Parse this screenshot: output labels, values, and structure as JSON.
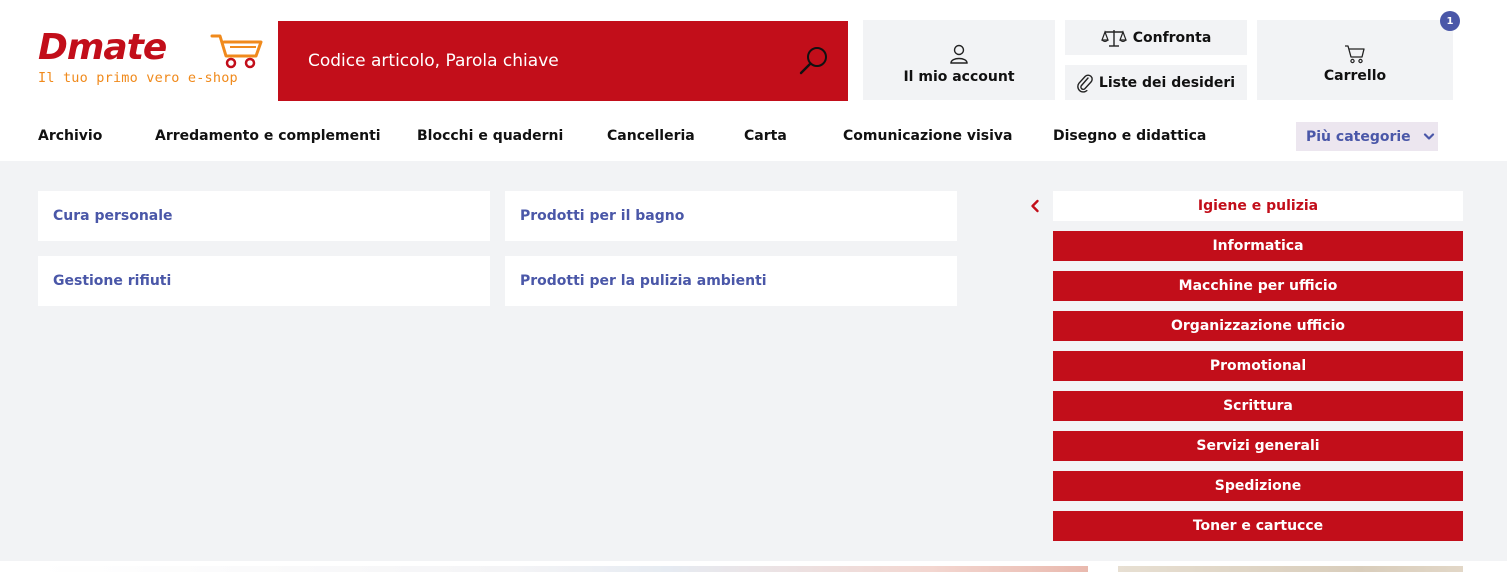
{
  "logo": {
    "brand": "Dmate",
    "tagline": "Il tuo primo vero e-shop"
  },
  "search": {
    "placeholder": "Codice articolo, Parola chiave"
  },
  "account": {
    "label": "Il mio account"
  },
  "compare": {
    "label": "Confronta"
  },
  "wishlist": {
    "label": "Liste dei desideri"
  },
  "cart": {
    "label": "Carrello",
    "count": "1"
  },
  "nav": {
    "items": [
      "Archivio",
      "Arredamento e complementi",
      "Blocchi e quaderni",
      "Cancelleria",
      "Carta",
      "Comunicazione visiva",
      "Disegno e didattica"
    ],
    "more_label": "Più categorie"
  },
  "panel": {
    "subcategories": [
      "Cura personale",
      "Prodotti per il bagno",
      "Gestione rifiuti",
      "Prodotti per la pulizia ambienti"
    ],
    "active_category": "Igiene e pulizia",
    "categories": [
      "Informatica",
      "Macchine per ufficio",
      "Organizzazione ufficio",
      "Promotional",
      "Scrittura",
      "Servizi generali",
      "Spedizione",
      "Toner e cartucce"
    ]
  },
  "colors": {
    "brand_red": "#c20e1a",
    "brand_orange": "#f08a1c",
    "link_blue": "#4a57a8",
    "panel_bg": "#f2f3f5"
  },
  "icons": [
    "cart-logo-icon",
    "search-icon",
    "user-icon",
    "scale-icon",
    "paperclip-icon",
    "cart-icon",
    "chevron-down-icon",
    "chevron-left-icon"
  ]
}
